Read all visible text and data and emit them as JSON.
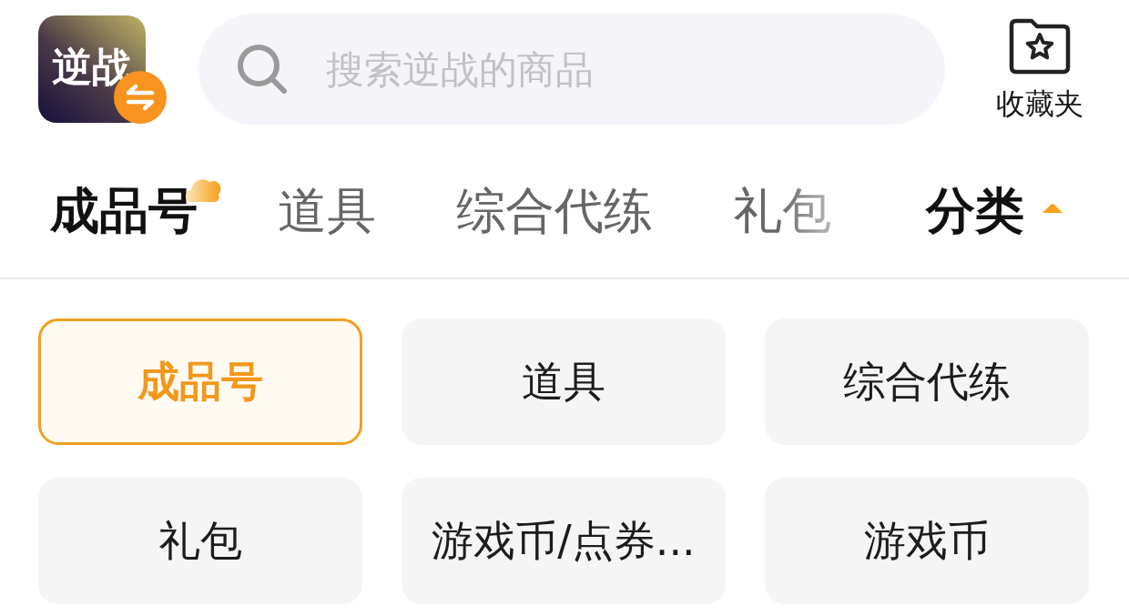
{
  "header": {
    "game_logo": {
      "text": "逆战"
    },
    "search": {
      "placeholder": "搜索逆战的商品"
    },
    "favorites": {
      "label": "收藏夹"
    }
  },
  "tabs": [
    {
      "label": "成品号",
      "selected": true
    },
    {
      "label": "道具",
      "selected": false
    },
    {
      "label": "综合代练",
      "selected": false
    },
    {
      "label": "礼包",
      "selected": false
    }
  ],
  "category_toggle": {
    "label": "分类",
    "expanded": true
  },
  "categories": [
    {
      "label": "成品号",
      "selected": true
    },
    {
      "label": "道具",
      "selected": false
    },
    {
      "label": "综合代练",
      "selected": false
    },
    {
      "label": "礼包",
      "selected": false
    },
    {
      "label": "游戏币/点券...",
      "selected": false
    },
    {
      "label": "游戏币",
      "selected": false
    }
  ]
}
